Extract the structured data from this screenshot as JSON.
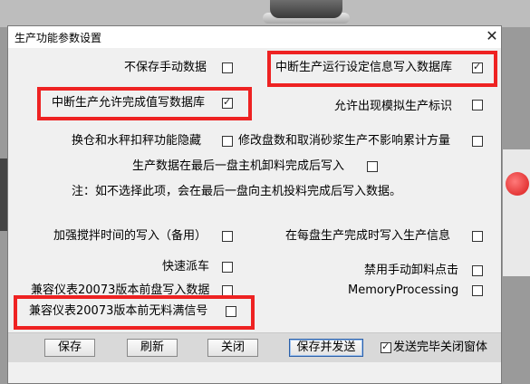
{
  "dialog": {
    "title": "生产功能参数设置",
    "close_glyph": "✕"
  },
  "options": [
    {
      "label": "不保存手动数据",
      "checked": false
    },
    {
      "label": "中断生产运行设定信息写入数据库",
      "checked": true
    },
    {
      "label": "中断生产允许完成值写数据库",
      "checked": true
    },
    {
      "label": "允许出现模拟生产标识",
      "checked": false
    },
    {
      "label": "换仓和水秤扣秤功能隐藏",
      "checked": false
    },
    {
      "label": "修改盘数和取消砂浆生产不影响累计方量",
      "checked": false
    },
    {
      "label": "生产数据在最后一盘主机卸料完成后写入",
      "checked": false
    },
    {
      "label": "加强搅拌时间的写入（备用）",
      "checked": false
    },
    {
      "label": "在每盘生产完成时写入生产信息",
      "checked": false
    },
    {
      "label": "快速派车",
      "checked": false
    },
    {
      "label": "禁用手动卸料点击",
      "checked": false
    },
    {
      "label": "兼容仪表20073版本前盘写入数据",
      "checked": false
    },
    {
      "label": "MemoryProcessing",
      "checked": false
    },
    {
      "label": "兼容仪表20073版本前无料满信号",
      "checked": false
    }
  ],
  "note": "注：如不选择此项，会在最后一盘向主机投料完成后写入数据。",
  "buttons": {
    "save": "保存",
    "refresh": "刷新",
    "close": "关闭",
    "save_send": "保存并发送"
  },
  "close_after_send": {
    "label": "发送完毕关闭窗体",
    "checked": true
  },
  "highlight_color": "#ee2222"
}
